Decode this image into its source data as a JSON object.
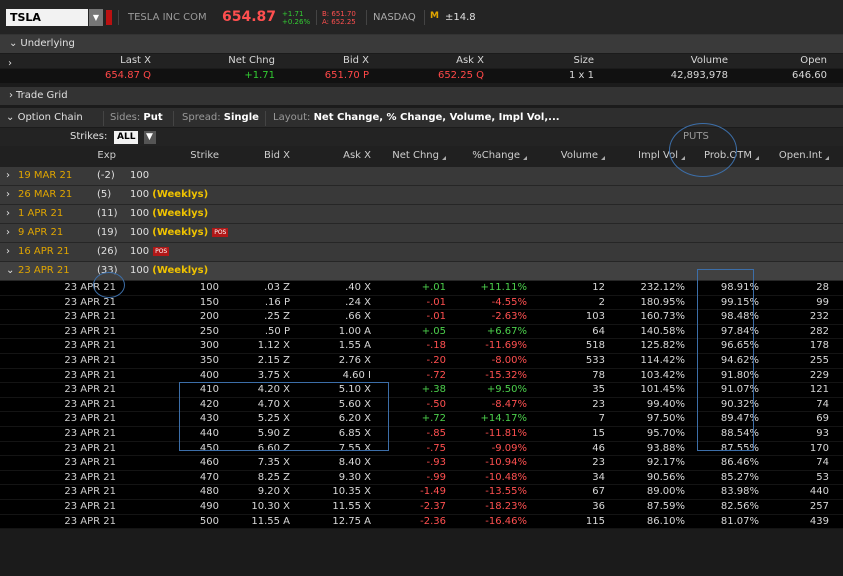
{
  "header": {
    "symbol": "TSLA",
    "company": "TESLA INC COM",
    "last": "654.87",
    "change_abs": "+1.71",
    "change_pct": "+0.26%",
    "bid": "B: 651.70",
    "ask": "A: 652.25",
    "exchange": "NASDAQ",
    "weekly_icon": "M",
    "expected_move": "±14.8"
  },
  "sections": {
    "underlying": "Underlying",
    "trade_grid": "Trade Grid",
    "option_chain": "Option Chain"
  },
  "underlying": {
    "headers": [
      "Last X",
      "Net Chng",
      "Bid X",
      "Ask X",
      "Size",
      "Volume",
      "Open"
    ],
    "values": [
      "654.87 Q",
      "+1.71",
      "651.70 P",
      "652.25 Q",
      "1 x 1",
      "42,893,978",
      "646.60"
    ]
  },
  "controls": {
    "sides_label": "Sides:",
    "sides_value": "Put",
    "spread_label": "Spread:",
    "spread_value": "Single",
    "layout_label": "Layout:",
    "layout_value": "Net Change, % Change, Volume, Impl Vol,...",
    "strikes_label": "Strikes:",
    "strikes_value": "ALL",
    "puts_label": "PUTS"
  },
  "columns": [
    "Exp",
    "Strike",
    "Bid X",
    "Ask X",
    "Net Chng",
    "%Change",
    "Volume",
    "Impl Vol",
    "Prob.OTM",
    "Open.Int"
  ],
  "expirations": [
    {
      "date": "19 MAR 21",
      "count": "(-2)",
      "mult": "100",
      "weekly": "",
      "pos": false
    },
    {
      "date": "26 MAR 21",
      "count": "(5)",
      "mult": "100",
      "weekly": "(Weeklys)",
      "pos": false
    },
    {
      "date": "1 APR 21",
      "count": "(11)",
      "mult": "100",
      "weekly": "(Weeklys)",
      "pos": false
    },
    {
      "date": "9 APR 21",
      "count": "(19)",
      "mult": "100",
      "weekly": "(Weeklys)",
      "pos": true
    },
    {
      "date": "16 APR 21",
      "count": "(26)",
      "mult": "100",
      "weekly": "",
      "pos": true
    },
    {
      "date": "23 APR 21",
      "count": "(33)",
      "mult": "100",
      "weekly": "(Weeklys)",
      "pos": false
    }
  ],
  "pos_badge": "POS",
  "rows": [
    [
      "23 APR 21",
      "100",
      ".03 Z",
      ".40 X",
      "+.01",
      "+11.11%",
      "12",
      "232.12%",
      "98.91%",
      "28"
    ],
    [
      "23 APR 21",
      "150",
      ".16 P",
      ".24 X",
      "-.01",
      "-4.55%",
      "2",
      "180.95%",
      "99.15%",
      "99"
    ],
    [
      "23 APR 21",
      "200",
      ".25 Z",
      ".66 X",
      "-.01",
      "-2.63%",
      "103",
      "160.73%",
      "98.48%",
      "232"
    ],
    [
      "23 APR 21",
      "250",
      ".50 P",
      "1.00 A",
      "+.05",
      "+6.67%",
      "64",
      "140.58%",
      "97.84%",
      "282"
    ],
    [
      "23 APR 21",
      "300",
      "1.12 X",
      "1.55 A",
      "-.18",
      "-11.69%",
      "518",
      "125.82%",
      "96.65%",
      "178"
    ],
    [
      "23 APR 21",
      "350",
      "2.15 Z",
      "2.76 X",
      "-.20",
      "-8.00%",
      "533",
      "114.42%",
      "94.62%",
      "255"
    ],
    [
      "23 APR 21",
      "400",
      "3.75 X",
      "4.60 I",
      "-.72",
      "-15.32%",
      "78",
      "103.42%",
      "91.80%",
      "229"
    ],
    [
      "23 APR 21",
      "410",
      "4.20 X",
      "5.10 X",
      "+.38",
      "+9.50%",
      "35",
      "101.45%",
      "91.07%",
      "121"
    ],
    [
      "23 APR 21",
      "420",
      "4.70 X",
      "5.60 X",
      "-.50",
      "-8.47%",
      "23",
      "99.40%",
      "90.32%",
      "74"
    ],
    [
      "23 APR 21",
      "430",
      "5.25 X",
      "6.20 X",
      "+.72",
      "+14.17%",
      "7",
      "97.50%",
      "89.47%",
      "69"
    ],
    [
      "23 APR 21",
      "440",
      "5.90 Z",
      "6.85 X",
      "-.85",
      "-11.81%",
      "15",
      "95.70%",
      "88.54%",
      "93"
    ],
    [
      "23 APR 21",
      "450",
      "6.60 Z",
      "7.55 X",
      "-.75",
      "-9.09%",
      "46",
      "93.88%",
      "87.55%",
      "170"
    ],
    [
      "23 APR 21",
      "460",
      "7.35 X",
      "8.40 X",
      "-.93",
      "-10.94%",
      "23",
      "92.17%",
      "86.46%",
      "74"
    ],
    [
      "23 APR 21",
      "470",
      "8.25 Z",
      "9.30 X",
      "-.99",
      "-10.48%",
      "34",
      "90.56%",
      "85.27%",
      "53"
    ],
    [
      "23 APR 21",
      "480",
      "9.20 X",
      "10.35 X",
      "-1.49",
      "-13.55%",
      "67",
      "89.00%",
      "83.98%",
      "440"
    ],
    [
      "23 APR 21",
      "490",
      "10.30 X",
      "11.55 X",
      "-2.37",
      "-18.23%",
      "36",
      "87.59%",
      "82.56%",
      "257"
    ],
    [
      "23 APR 21",
      "500",
      "11.55 A",
      "12.75 A",
      "-2.36",
      "-16.46%",
      "115",
      "86.10%",
      "81.07%",
      "439"
    ]
  ]
}
